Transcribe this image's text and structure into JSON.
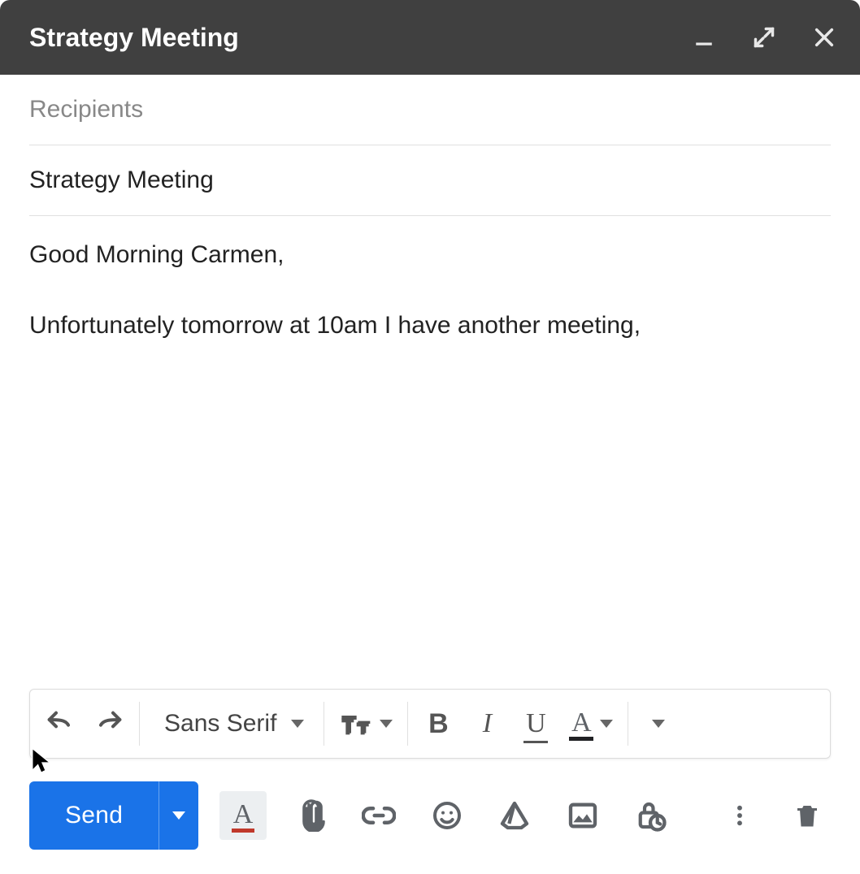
{
  "window": {
    "title": "Strategy Meeting"
  },
  "fields": {
    "recipients_placeholder": "Recipients",
    "recipients_value": "",
    "subject_value": "Strategy Meeting"
  },
  "body": {
    "text": "Good Morning Carmen,\n\nUnfortunately tomorrow at 10am I have another meeting,"
  },
  "formatToolbar": {
    "font_family": "Sans Serif"
  },
  "bottomBar": {
    "send_label": "Send"
  },
  "icons": {
    "minimize": "minimize",
    "fullscreen": "fullscreen",
    "close": "close",
    "undo": "undo",
    "redo": "redo",
    "font_size": "font-size",
    "bold": "bold",
    "italic": "italic",
    "underline": "underline",
    "text_color": "text-color",
    "more_format": "more-format",
    "format_options": "format-options",
    "attach": "attach",
    "link": "link",
    "emoji": "emoji",
    "drive": "drive",
    "image": "image",
    "confidential": "confidential",
    "more": "more",
    "trash": "trash"
  }
}
